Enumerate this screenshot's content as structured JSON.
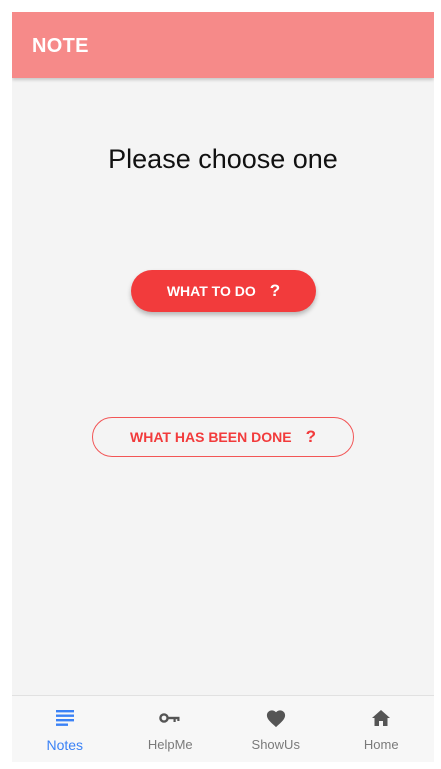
{
  "appbar": {
    "title": "NOTE"
  },
  "main": {
    "heading": "Please choose one",
    "primary_button": {
      "label": "WHAT TO DO",
      "suffix": "?"
    },
    "secondary_button": {
      "label": "WHAT HAS BEEN DONE",
      "suffix": "?"
    }
  },
  "bottom_nav": {
    "items": [
      {
        "label": "Notes",
        "icon": "notes-list-icon",
        "active": true
      },
      {
        "label": "HelpMe",
        "icon": "key-icon",
        "active": false
      },
      {
        "label": "ShowUs",
        "icon": "heart-icon",
        "active": false
      },
      {
        "label": "Home",
        "icon": "home-icon",
        "active": false
      }
    ]
  },
  "colors": {
    "appbar": "#f68a89",
    "accent": "#f23b3c",
    "nav_active": "#3b82f6",
    "nav_inactive": "#555555"
  }
}
